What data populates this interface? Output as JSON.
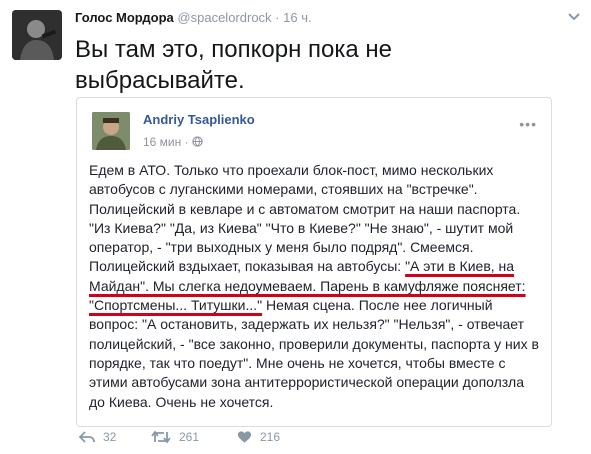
{
  "tweet": {
    "author_name": "Голос Мордора",
    "author_handle": "@spacelordrock",
    "separator": "·",
    "time": "16 ч.",
    "text": "Вы там это, попкорн пока не выбрасывайте."
  },
  "quoted_post": {
    "author_name": "Andriy Tsaplienko",
    "time": "16 мин",
    "body": {
      "part1": "Едем в АТО. Только что проехали блок-пост, мимо нескольких автобусов с луганскими номерами, стоявших на \"встречке\". Полицейский в кевларе и с автоматом смотрит на наши паспорта. \"Из Киева?\" \"Да, из Киева\" \"Что в Киеве?\" \"Не знаю\", - шутит мой оператор, - \"три выходных у меня было подряд\". Смеемся. Полицейский вздыхает, показывая на автобусы: ",
      "underline1": "\"А эти в Киев, на Майдан\". Мы слегка недоумеваем. Парень в камуфляже поясняет: \"Спортсмены... Титушки...\"",
      "part2": " Немая сцена. После нее логичный вопрос: \"А остановить, задержать их нельзя?\" \"Нельзя\", - отвечает полицейский, - \"все законно, проверили документы, паспорта у них в порядке, так что поедут\". Мне очень не хочется, чтобы вместе с этими автобусами зона антитеррористической операции доползла до Киева. Очень не хочется."
    }
  },
  "actions": {
    "replies": "32",
    "retweets": "261",
    "likes": "216"
  },
  "icons": [
    "reply-icon",
    "retweet-icon",
    "like-icon",
    "chevron-down-icon",
    "globe-icon",
    "more-icon"
  ],
  "colors": {
    "link_blue": "#365899",
    "underline_red": "#d0021b",
    "meta_gray": "#8899a6"
  }
}
